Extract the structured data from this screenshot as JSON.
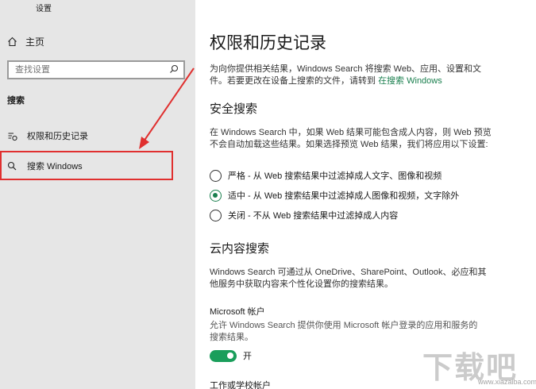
{
  "window": {
    "title": "设置"
  },
  "sidebar": {
    "home_label": "主页",
    "search_placeholder": "查找设置",
    "section_title": "搜索",
    "items": [
      {
        "label": "权限和历史记录",
        "icon": "history-list-icon"
      },
      {
        "label": "搜索 Windows",
        "icon": "search-icon"
      }
    ]
  },
  "main": {
    "title": "权限和历史记录",
    "description": "为向你提供相关结果，Windows Search 将搜索 Web、应用、设置和文件。若要更改在设备上搜索的文件，请转到 ",
    "description_link": "在搜索 Windows",
    "safe_search": {
      "heading": "安全搜索",
      "description": "在 Windows Search 中，如果 Web 结果可能包含成人内容，则 Web 预览不会自动加载这些结果。如果选择预览 Web 结果，我们将应用以下设置:",
      "options": [
        {
          "label": "严格 - 从 Web 搜索结果中过滤掉成人文字、图像和视频",
          "selected": false
        },
        {
          "label": "适中 - 从 Web 搜索结果中过滤掉成人图像和视频，文字除外",
          "selected": true
        },
        {
          "label": "关闭 - 不从 Web 搜索结果中过滤掉成人内容",
          "selected": false
        }
      ]
    },
    "cloud_search": {
      "heading": "云内容搜索",
      "description": "Windows Search 可通过从 OneDrive、SharePoint、Outlook、必应和其他服务中获取内容来个性化设置你的搜索结果。",
      "microsoft_account_label": "Microsoft 帐户",
      "microsoft_account_desc": "允许 Windows Search 提供你使用 Microsoft 帐户登录的应用和服务的搜索结果。",
      "toggle_state_label": "开",
      "toggle_on": true,
      "work_account_label": "工作或学校帐户"
    }
  },
  "watermark": {
    "logo": "下载吧",
    "url": "www.xiazaiba.com"
  },
  "colors": {
    "accent": "#1a7f4e",
    "toggle": "#1a9e5b",
    "highlight": "#e0302f",
    "sidebar_bg": "#e6e6e6"
  }
}
